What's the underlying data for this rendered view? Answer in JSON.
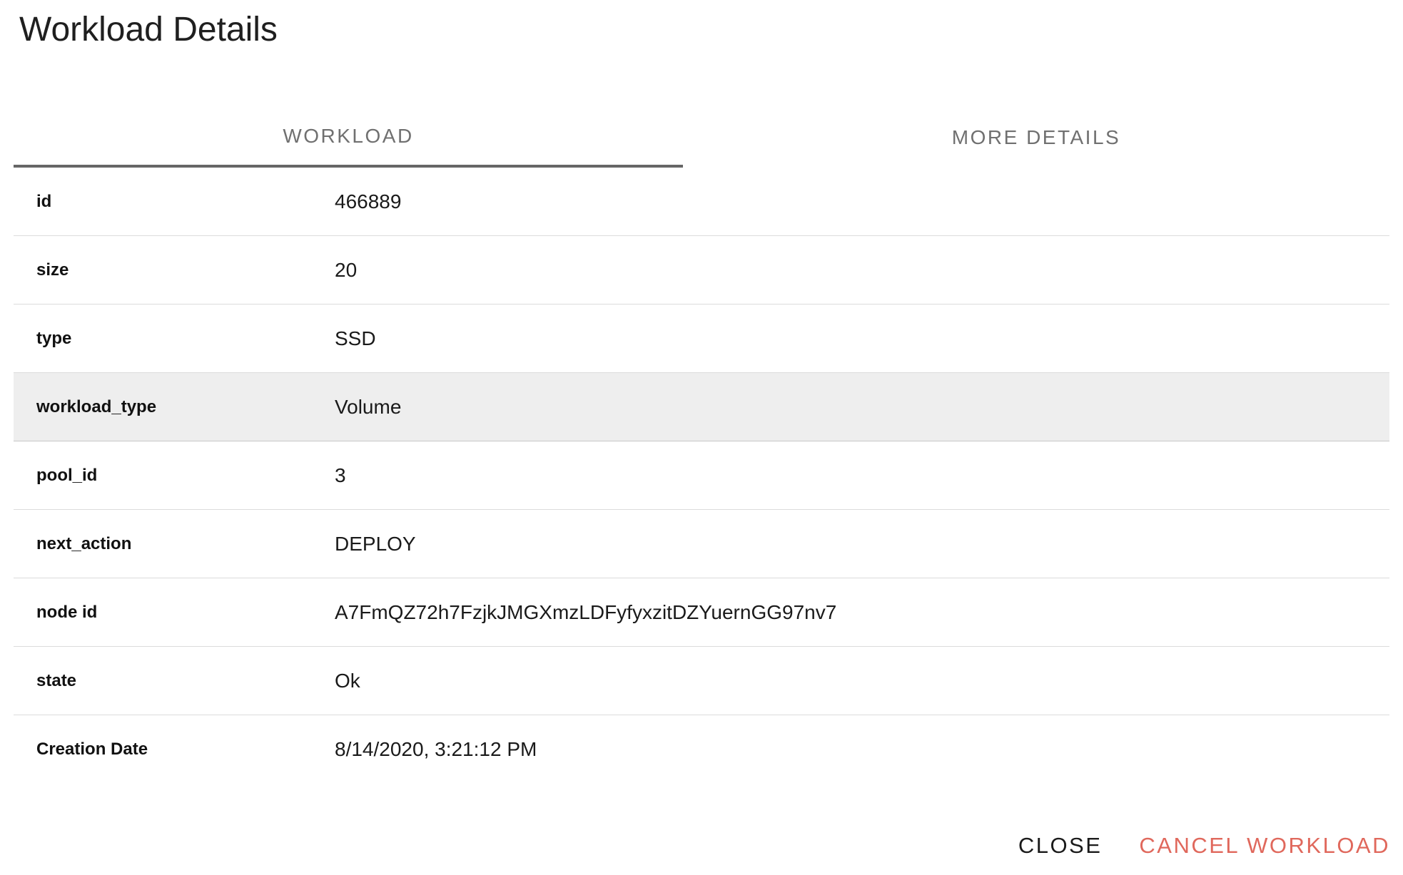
{
  "dialog": {
    "title": "Workload Details"
  },
  "tabs": [
    {
      "label": "WORKLOAD",
      "active": true
    },
    {
      "label": "MORE DETAILS",
      "active": false
    }
  ],
  "rows": [
    {
      "key": "id",
      "value": "466889"
    },
    {
      "key": "size",
      "value": "20"
    },
    {
      "key": "type",
      "value": "SSD"
    },
    {
      "key": "workload_type",
      "value": "Volume"
    },
    {
      "key": "pool_id",
      "value": "3"
    },
    {
      "key": "next_action",
      "value": "DEPLOY"
    },
    {
      "key": "node id",
      "value": "A7FmQZ72h7FzjkJMGXmzLDFyfyxzitDZYuernGG97nv7"
    },
    {
      "key": "state",
      "value": "Ok"
    },
    {
      "key": "Creation Date",
      "value": "8/14/2020, 3:21:12 PM"
    }
  ],
  "actions": {
    "close_label": "CLOSE",
    "cancel_label": "CANCEL WORKLOAD"
  },
  "colors": {
    "cancel_accent": "#e0685c",
    "tab_indicator": "#666666",
    "row_highlight": "#eeeeee"
  }
}
